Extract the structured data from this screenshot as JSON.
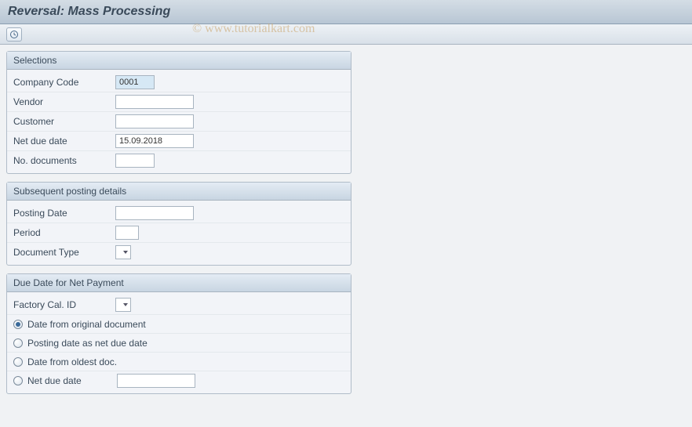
{
  "title": "Reversal: Mass Processing",
  "watermark": "© www.tutorialkart.com",
  "toolbar": {
    "execute_icon": "execute"
  },
  "groups": {
    "selections": {
      "title": "Selections",
      "fields": {
        "company_code": {
          "label": "Company Code",
          "value": "0001"
        },
        "vendor": {
          "label": "Vendor",
          "value": ""
        },
        "customer": {
          "label": "Customer",
          "value": ""
        },
        "net_due_date": {
          "label": "Net due date",
          "value": "15.09.2018"
        },
        "no_documents": {
          "label": "No. documents",
          "value": ""
        }
      }
    },
    "posting": {
      "title": "Subsequent posting details",
      "fields": {
        "posting_date": {
          "label": "Posting Date",
          "value": ""
        },
        "period": {
          "label": "Period",
          "value": ""
        },
        "doc_type": {
          "label": "Document Type",
          "value": ""
        }
      }
    },
    "due": {
      "title": "Due Date for Net Payment",
      "factory_cal": {
        "label": "Factory Cal. ID",
        "value": ""
      },
      "options": {
        "o1": "Date from original document",
        "o2": "Posting date as net due date",
        "o3": "Date from oldest doc.",
        "o4": "Net due date"
      },
      "net_due_value": ""
    }
  }
}
